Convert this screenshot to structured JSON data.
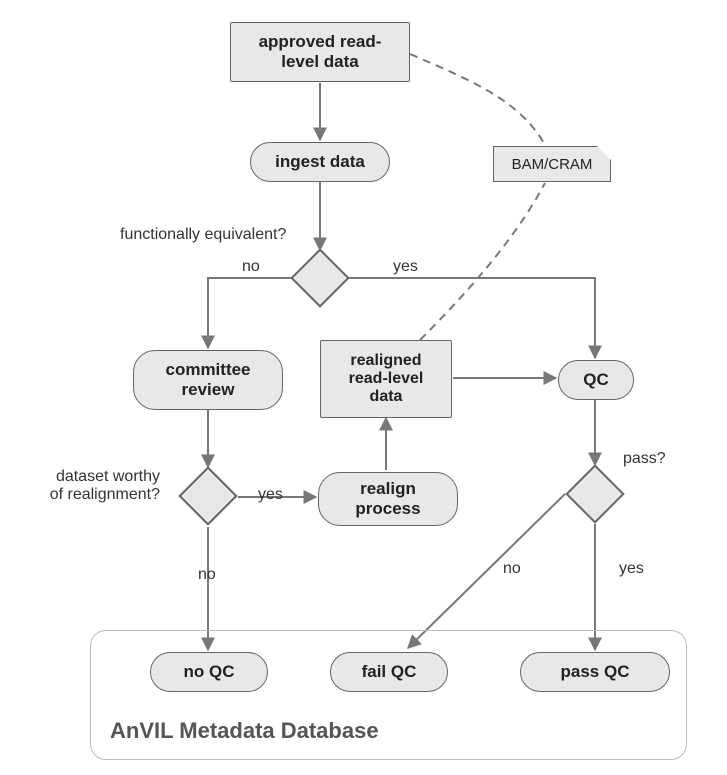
{
  "nodes": {
    "approved_read_level_data": "approved read-\nlevel data",
    "ingest_data": "ingest data",
    "bam_cram": "BAM/CRAM",
    "committee_review": "committee\nreview",
    "realigned_read_level_data": "realigned\nread-level\ndata",
    "qc": "QC",
    "realign_process": "realign\nprocess",
    "no_qc": "no QC",
    "fail_qc": "fail QC",
    "pass_qc": "pass QC"
  },
  "decisions": {
    "functionally_equivalent": "functionally equivalent?",
    "dataset_worthy": "dataset worthy\nof realignment?",
    "pass": "pass?"
  },
  "edge_labels": {
    "no": "no",
    "yes": "yes"
  },
  "container": {
    "title": "AnVIL Metadata Database"
  }
}
